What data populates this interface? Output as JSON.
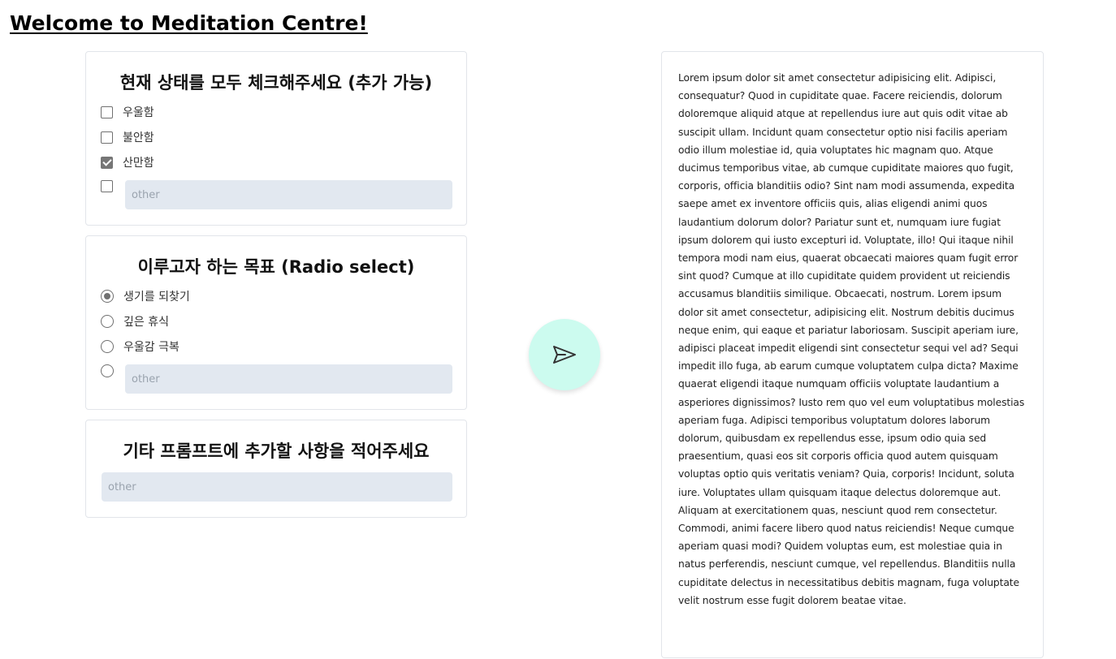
{
  "page": {
    "title": "Welcome to Meditation Centre!"
  },
  "state_section": {
    "title": "현재 상태를 모두 체크해주세요 (추가 가능)",
    "options": [
      {
        "label": "우울함",
        "checked": false
      },
      {
        "label": "불안함",
        "checked": false
      },
      {
        "label": "산만함",
        "checked": true
      }
    ],
    "other_checked": false,
    "other_placeholder": "other"
  },
  "goal_section": {
    "title": "이루고자 하는 목표 (Radio select)",
    "options": [
      {
        "label": "생기를 되찾기",
        "selected": true
      },
      {
        "label": "깊은 휴식",
        "selected": false
      },
      {
        "label": "우울감 극복",
        "selected": false
      }
    ],
    "other_selected": false,
    "other_placeholder": "other"
  },
  "prompt_section": {
    "title": "기타 프롬프트에 추가할 사항을 적어주세요",
    "placeholder": "other"
  },
  "send_button": {
    "icon": "send-icon"
  },
  "output": {
    "text": "Lorem ipsum dolor sit amet consectetur adipisicing elit. Adipisci, consequatur? Quod in cupiditate quae. Facere reiciendis, dolorum doloremque aliquid atque at repellendus iure aut quis odit vitae ab suscipit ullam. Incidunt quam consectetur optio nisi facilis aperiam odio illum molestiae id, quia voluptates hic magnam quo. Atque ducimus temporibus vitae, ab cumque cupiditate maiores quo fugit, corporis, officia blanditiis odio? Sint nam modi assumenda, expedita saepe amet ex inventore officiis quis, alias eligendi animi quos laudantium dolorum dolor? Pariatur sunt et, numquam iure fugiat ipsum dolorem qui iusto excepturi id. Voluptate, illo! Qui itaque nihil tempora modi nam eius, quaerat obcaecati maiores quam fugit error sint quod? Cumque at illo cupiditate quidem provident ut reiciendis accusamus blanditiis similique. Obcaecati, nostrum. Lorem ipsum dolor sit amet consectetur, adipisicing elit. Nostrum debitis ducimus neque enim, qui eaque et pariatur laboriosam. Suscipit aperiam iure, adipisci placeat impedit eligendi sint consectetur sequi vel ad? Sequi impedit illo fuga, ab earum cumque voluptatem culpa dicta? Maxime quaerat eligendi itaque numquam officiis voluptate laudantium a asperiores dignissimos? Iusto rem quo vel eum voluptatibus molestias aperiam fuga. Adipisci temporibus voluptatum dolores laborum dolorum, quibusdam ex repellendus esse, ipsum odio quia sed praesentium, quasi eos sit corporis officia quod autem quisquam voluptas optio quis veritatis veniam? Quia, corporis! Incidunt, soluta iure. Voluptates ullam quisquam itaque delectus doloremque aut. Aliquam at exercitationem quas, nesciunt quod rem consectetur. Commodi, animi facere libero quod natus reiciendis! Neque cumque aperiam quasi modi? Quidem voluptas eum, est molestiae quia in natus perferendis, nesciunt cumque, vel repellendus. Blanditiis nulla cupiditate delectus in necessitatibus debitis magnam, fuga voluptate velit nostrum esse fugit dolorem beatae vitae."
  }
}
